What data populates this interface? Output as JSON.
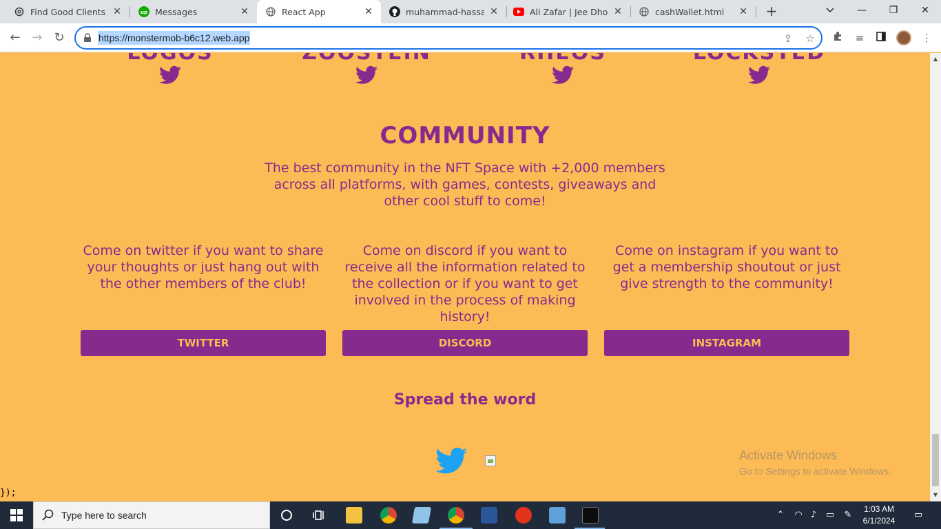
{
  "browser": {
    "tabs": [
      {
        "title": "Find Good Clients Upv",
        "icon": "openai-icon"
      },
      {
        "title": "Messages",
        "icon": "upwork-icon"
      },
      {
        "title": "React App",
        "icon": "globe-icon"
      },
      {
        "title": "muhammad-hassan-n",
        "icon": "github-icon"
      },
      {
        "title": "Ali Zafar | Jee Dhoond",
        "icon": "youtube-icon"
      },
      {
        "title": "cashWallet.html",
        "icon": "globe-icon"
      }
    ],
    "url": "https://monstermob-b6c12.web.app"
  },
  "page": {
    "team_names": [
      "LOGOS",
      "ZOOSTEIN",
      "RHEOS",
      "LOCKSTED"
    ],
    "community": {
      "title": "COMMUNITY",
      "text": "The best community in the NFT Space with +2,000 members across all platforms, with games, contests, giveaways and other cool stuff to come!"
    },
    "columns": [
      {
        "text": "Come on twitter if you want to share your thoughts or just hang out with the other members of the club!",
        "button": "TWITTER"
      },
      {
        "text": "Come on discord if you want to receive all the information related to the collection or if you want to get involved in the process of making history!",
        "button": "DISCORD"
      },
      {
        "text": "Come on instagram if you want to get a membership shoutout or just give strength to the community!",
        "button": "INSTAGRAM"
      }
    ],
    "spread": "Spread the word",
    "stray_text": "});",
    "watermark": {
      "title": "Activate Windows",
      "subtitle": "Go to Settings to activate Windows."
    }
  },
  "taskbar": {
    "search_placeholder": "Type here to search",
    "time": "1:03 AM",
    "date": "6/1/2024"
  },
  "colors": {
    "background": "#fdbb55",
    "accent": "#862a8e",
    "twitter_blue": "#1da1f2"
  }
}
